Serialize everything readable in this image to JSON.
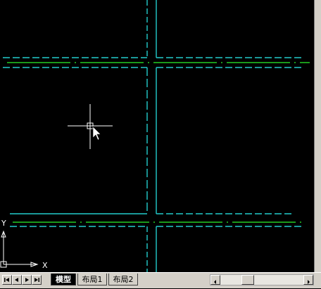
{
  "layout_tabs": [
    {
      "label": "模型",
      "active": true
    },
    {
      "label": "布局1",
      "active": false
    },
    {
      "label": "布局2",
      "active": false
    }
  ],
  "ucs": {
    "x_label": "X",
    "y_label": "Y"
  },
  "colors": {
    "background": "#000000",
    "centerline": "#22cc22",
    "road_edge": "#22cccc",
    "crosshair": "#ffffff",
    "panel": "#d4d0c8"
  },
  "icons": {
    "nav_first": "first-tab-icon",
    "nav_prev": "prev-tab-icon",
    "nav_next": "next-tab-icon",
    "nav_last": "last-tab-icon",
    "scroll_left": "scroll-left-icon",
    "scroll_right": "scroll-right-icon"
  }
}
